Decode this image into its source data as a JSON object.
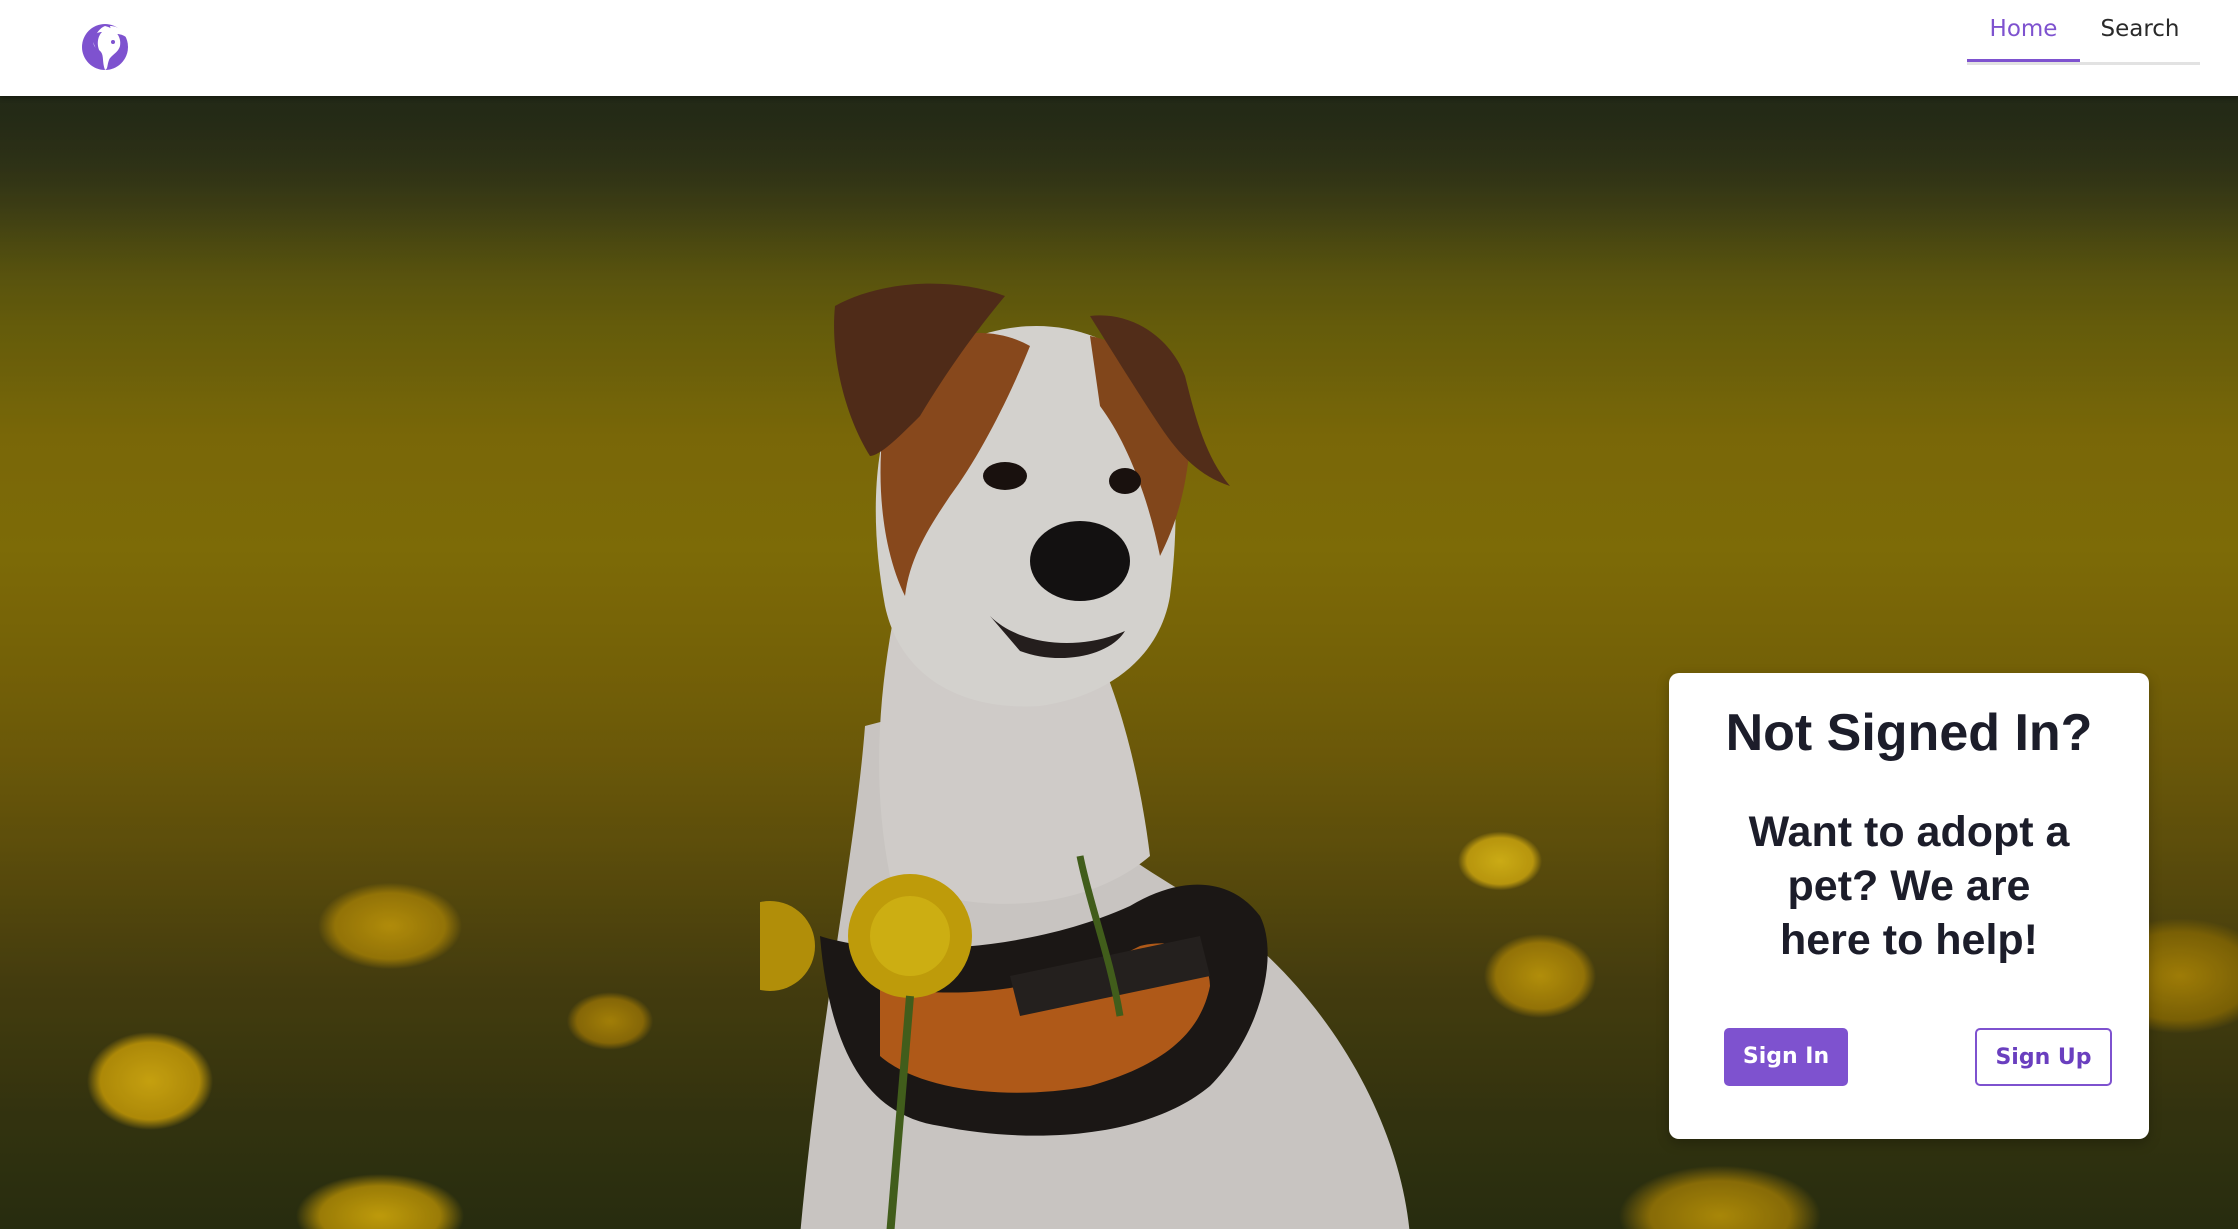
{
  "brand": {
    "logo_icon": "pet-head-logo-icon",
    "accent_color": "#7e52cf"
  },
  "nav": {
    "tabs": [
      {
        "label": "Home",
        "active": true
      },
      {
        "label": "Search",
        "active": false
      }
    ]
  },
  "hero": {
    "image": "jack-russell-terrier-in-dandelion-field"
  },
  "card": {
    "title": "Not Signed In?",
    "subtitle": "Want to adopt a pet? We are here to help!",
    "sign_in_label": "Sign In",
    "sign_up_label": "Sign Up"
  }
}
